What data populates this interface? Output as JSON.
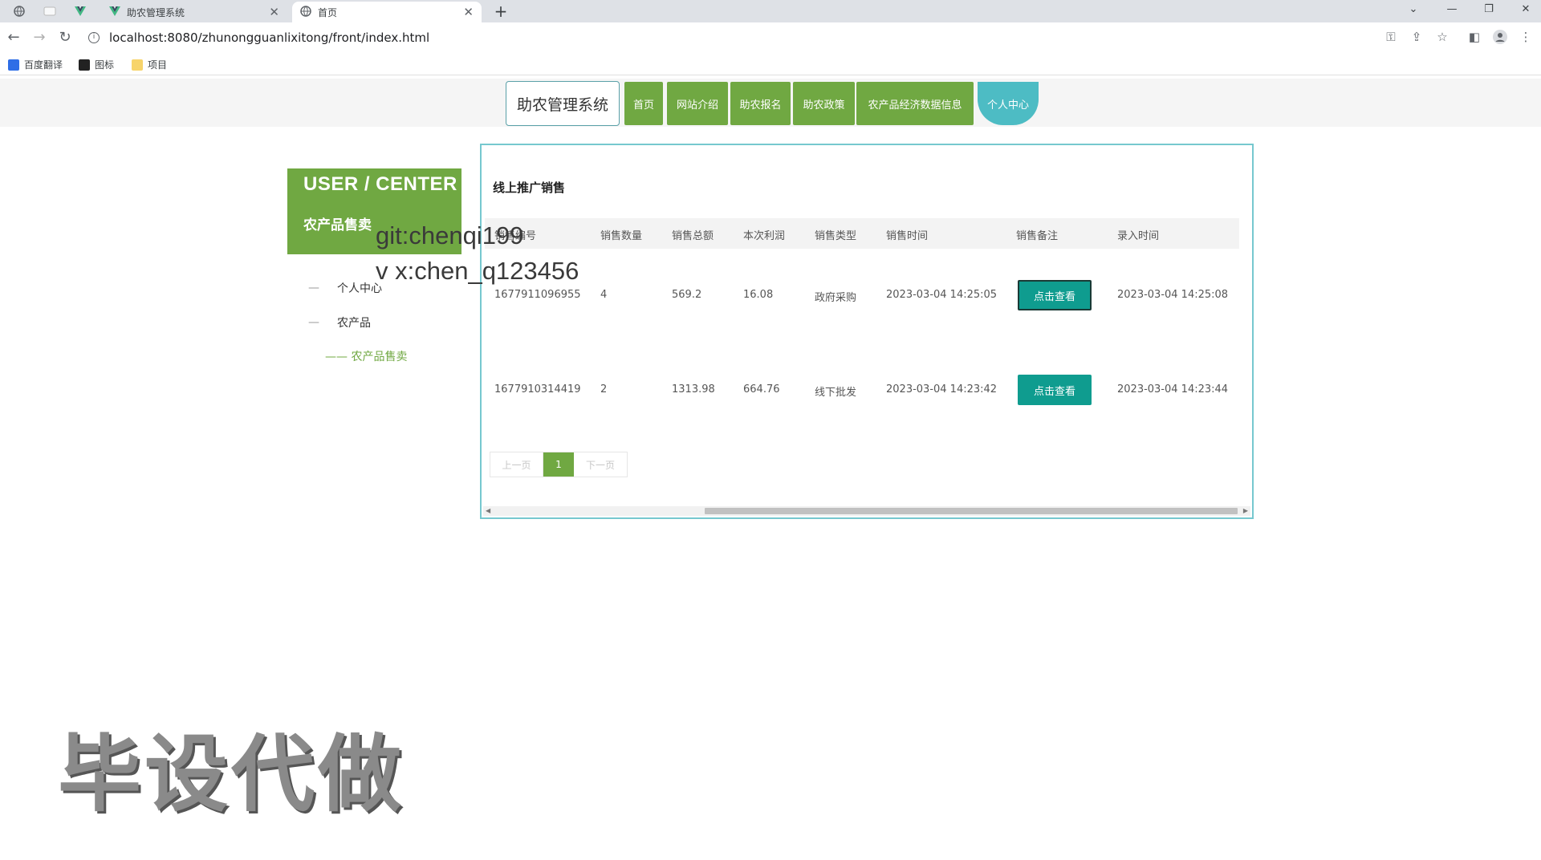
{
  "browser": {
    "tabs": [
      {
        "title": "助农管理系统",
        "icon": "vue-logo-icon"
      },
      {
        "title": "首页",
        "icon": "globe-icon"
      }
    ],
    "new_tab": "+",
    "url": "localhost:8080/zhunongguanlixitong/front/index.html",
    "bookmarks": [
      "百度翻译",
      "图标",
      "项目"
    ]
  },
  "nav": {
    "brand": "助农管理系统",
    "items": [
      "首页",
      "网站介绍",
      "助农报名",
      "助农政策",
      "农产品经济数据信息",
      "个人中心"
    ],
    "active": "个人中心",
    "colors": {
      "item": "#70a842",
      "active": "#4dbcc4"
    }
  },
  "sidebar": {
    "title_en": "USER / CENTER",
    "title_zh": "农产品售卖",
    "menu": [
      "个人中心",
      "农产品"
    ],
    "submenu": "—— 农产品售卖"
  },
  "panel": {
    "title": "线上推广销售",
    "columns": [
      "销售编号",
      "销售数量",
      "销售总额",
      "本次利润",
      "销售类型",
      "销售时间",
      "销售备注",
      "录入时间"
    ],
    "rows": [
      {
        "id": "1677911096955",
        "qty": "4",
        "total": "569.2",
        "profit": "16.08",
        "type": "政府采购",
        "time": "2023-03-04 14:25:05",
        "action": "点击查看",
        "created": "2023-03-04 14:25:08"
      },
      {
        "id": "1677910314419",
        "qty": "2",
        "total": "1313.98",
        "profit": "664.76",
        "type": "线下批发",
        "time": "2023-03-04 14:23:42",
        "action": "点击查看",
        "created": "2023-03-04 14:23:44"
      }
    ],
    "pager": {
      "prev": "上一页",
      "current": "1",
      "next": "下一页"
    }
  },
  "overlay": {
    "line1": "git:chenqi199",
    "line2": "v x:chen_q123456",
    "big": "毕设代做"
  }
}
